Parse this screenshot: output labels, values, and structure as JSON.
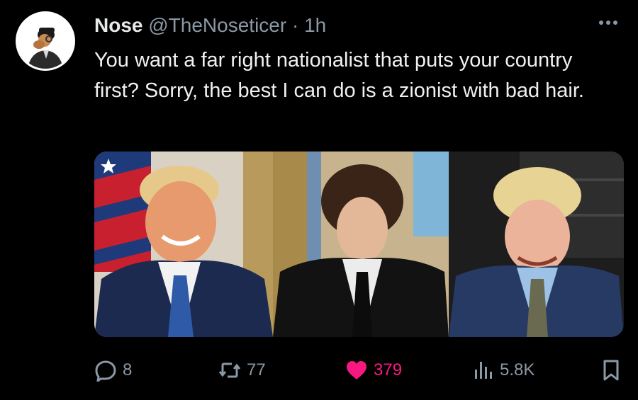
{
  "author": {
    "display_name": "Nose",
    "handle": "@TheNoseticer",
    "separator": "·",
    "time": "1h"
  },
  "tweet": {
    "text": "You want a far right nationalist that puts your country first? Sorry, the best I can do is a zionist with bad hair."
  },
  "media": {
    "panels": [
      {
        "name": "left-photo",
        "background": "#c7b79a"
      },
      {
        "name": "middle-photo",
        "background": "#b89866"
      },
      {
        "name": "right-photo",
        "background": "#2a2a2a"
      }
    ]
  },
  "actions": {
    "replies": "8",
    "retweets": "77",
    "likes": "379",
    "views": "5.8K"
  },
  "colors": {
    "background": "#000000",
    "text": "#e7e9ea",
    "muted": "#8b98a5",
    "like": "#f91880"
  },
  "icons": [
    "more-icon",
    "reply-icon",
    "retweet-icon",
    "heart-icon",
    "views-icon",
    "bookmark-icon"
  ]
}
